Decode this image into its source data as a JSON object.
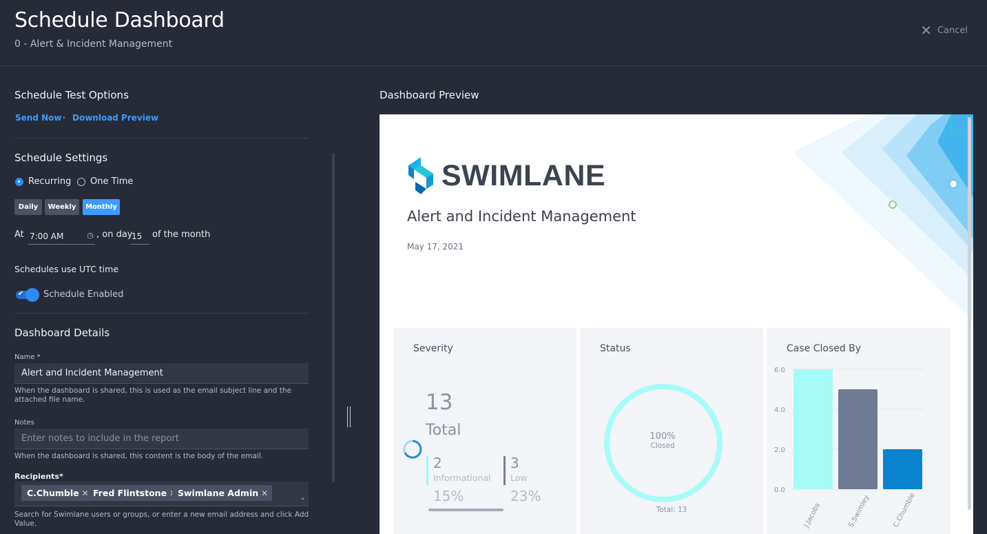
{
  "header": {
    "title": "Schedule Dashboard",
    "subtitle": "0 - Alert & Incident Management",
    "cancel_label": "Cancel"
  },
  "test_options": {
    "title": "Schedule Test Options",
    "send_now": "Send Now",
    "separator": "•",
    "download_preview": "Download Preview"
  },
  "schedule_settings": {
    "title": "Schedule Settings",
    "type_options": [
      "Recurring",
      "One Time"
    ],
    "type_selected": "Recurring",
    "frequency_options": [
      "Daily",
      "Weekly",
      "Monthly"
    ],
    "frequency_selected": "Monthly",
    "at_label": "At",
    "time_value": "7:00 AM",
    "on_day_label": ", on day",
    "day_value": "15",
    "of_month_label": "of the month",
    "utc_note": "Schedules use UTC time",
    "enabled_label": "Schedule Enabled",
    "enabled": true
  },
  "dashboard_details": {
    "title": "Dashboard Details",
    "name_label": "Name *",
    "name_value": "Alert and Incident Management",
    "name_help": "When the dashboard is shared, this is used as the email subject line and the attached file name.",
    "notes_label": "Notes",
    "notes_placeholder": "Enter notes to include in the report",
    "notes_help": "When the dashboard is shared, this content is the body of the email.",
    "recipients_label": "Recipients*",
    "recipients": [
      "C.Chumble",
      "Fred Flintstone",
      "Swimlane Admin"
    ],
    "recipients_help": "Search for Swimlane users or groups, or enter a new email address and click Add Value."
  },
  "preview": {
    "title": "Dashboard Preview",
    "logo_text": "SWIMLANE",
    "report_title": "Alert and Incident Management",
    "report_date": "May 17, 2021",
    "severity": {
      "title": "Severity",
      "total": "13",
      "total_label": "Total",
      "items": [
        {
          "count": "2",
          "label": "Informational",
          "pct": "15%",
          "color": "#9ff6f1"
        },
        {
          "count": "3",
          "label": "Low",
          "pct": "23%",
          "color": "#757f98"
        }
      ]
    },
    "status": {
      "title": "Status",
      "center_pct": "100%",
      "center_label": "Closed",
      "total": "Total: 13",
      "color": "#a8fbf7"
    }
  },
  "chart_data": {
    "type": "bar",
    "title": "Case Closed By",
    "categories": [
      "J.Jacobs",
      "S.Swimley",
      "C.Chumble"
    ],
    "values": [
      6,
      5,
      2
    ],
    "colors": [
      "#a6fbf6",
      "#6f7a94",
      "#0a83cf"
    ],
    "y_ticks": [
      "0.0",
      "2.0",
      "4.0",
      "6.0"
    ],
    "ylim": [
      0,
      6
    ],
    "grid": true
  }
}
